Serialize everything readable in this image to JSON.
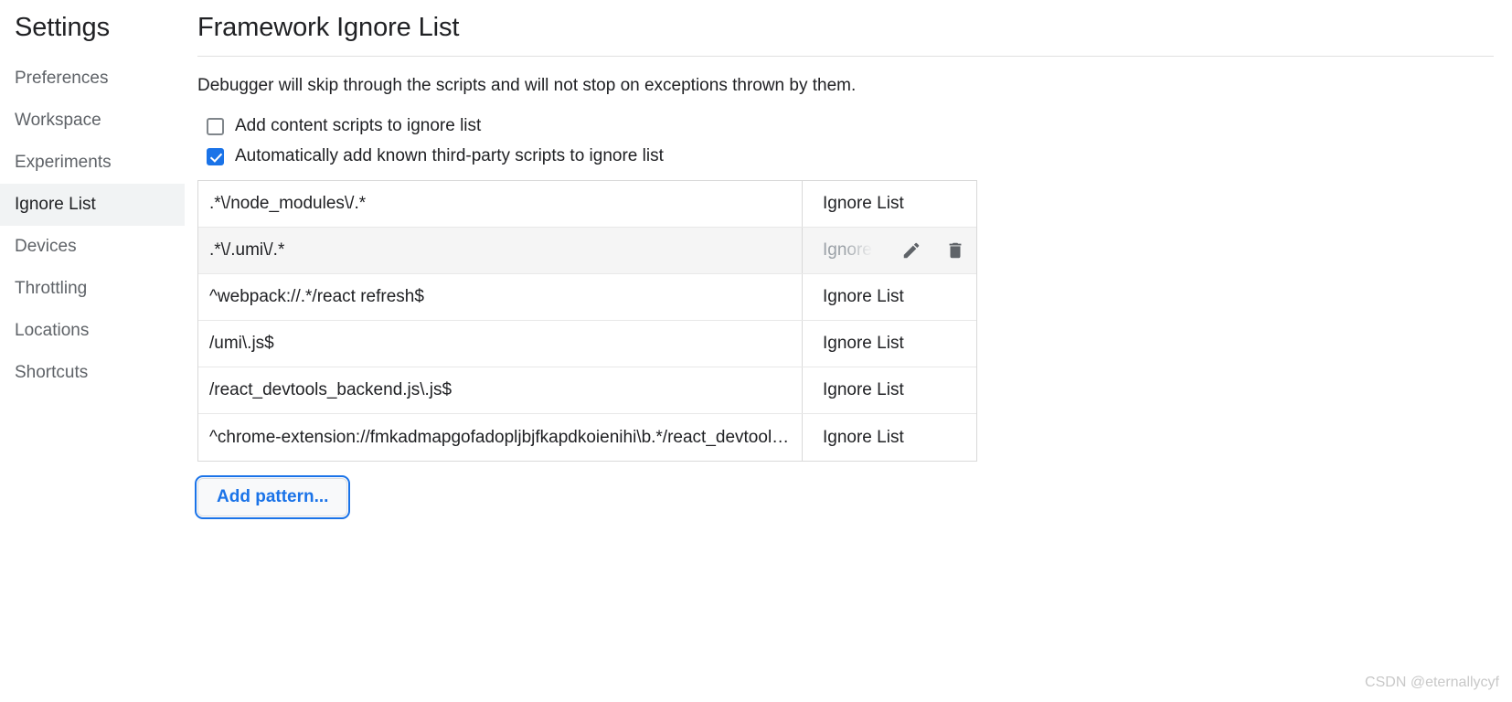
{
  "sidebar": {
    "title": "Settings",
    "items": [
      {
        "label": "Preferences",
        "selected": false
      },
      {
        "label": "Workspace",
        "selected": false
      },
      {
        "label": "Experiments",
        "selected": false
      },
      {
        "label": "Ignore List",
        "selected": true
      },
      {
        "label": "Devices",
        "selected": false
      },
      {
        "label": "Throttling",
        "selected": false
      },
      {
        "label": "Locations",
        "selected": false
      },
      {
        "label": "Shortcuts",
        "selected": false
      }
    ]
  },
  "main": {
    "title": "Framework Ignore List",
    "description": "Debugger will skip through the scripts and will not stop on exceptions thrown by them.",
    "checkboxes": [
      {
        "label": "Add content scripts to ignore list",
        "checked": false
      },
      {
        "label": "Automatically add known third-party scripts to ignore list",
        "checked": true
      }
    ],
    "table": {
      "rows": [
        {
          "pattern": ".*\\/node_modules\\/.*",
          "behavior": "Ignore List",
          "hovered": false
        },
        {
          "pattern": ".*\\/.umi\\/.*",
          "behavior": "Ignore List",
          "hovered": true
        },
        {
          "pattern": "^webpack://.*/react refresh$",
          "behavior": "Ignore List",
          "hovered": false
        },
        {
          "pattern": "/umi\\.js$",
          "behavior": "Ignore List",
          "hovered": false
        },
        {
          "pattern": "/react_devtools_backend.js\\.js$",
          "behavior": "Ignore List",
          "hovered": false
        },
        {
          "pattern": "^chrome-extension://fmkadmapgofadopljbjfkapdkoienihi\\b.*/react_devtools_backend.js$",
          "behavior": "Ignore List",
          "hovered": false
        }
      ],
      "actions": {
        "edit_label": "Edit",
        "delete_label": "Remove"
      }
    },
    "add_pattern_label": "Add pattern..."
  },
  "watermark": "CSDN @eternallycyf",
  "colors": {
    "accent": "#1a73e8",
    "selected_bg": "#f1f3f4",
    "hover_bg": "#f5f5f5",
    "text": "#202124",
    "muted_text": "#5f6368"
  }
}
